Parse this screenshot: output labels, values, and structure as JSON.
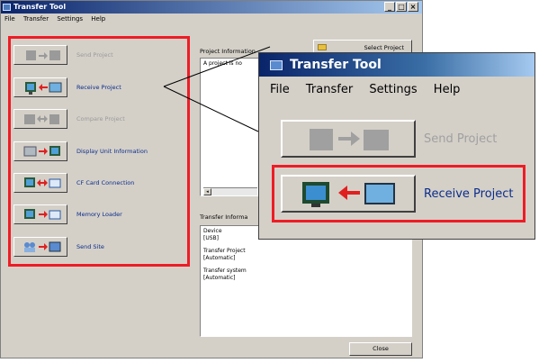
{
  "main_window": {
    "title": "Transfer Tool",
    "controls": {
      "minimize": "_",
      "maximize": "□",
      "close": "×"
    },
    "menu": [
      "File",
      "Transfer",
      "Settings",
      "Help"
    ],
    "buttons": [
      {
        "label": "Send Project",
        "enabled": false
      },
      {
        "label": "Receive Project",
        "enabled": true
      },
      {
        "label": "Compare Project",
        "enabled": false
      },
      {
        "label": "Display Unit Information",
        "enabled": true
      },
      {
        "label": "CF Card Connection",
        "enabled": true
      },
      {
        "label": "Memory Loader",
        "enabled": true
      },
      {
        "label": "Send Site",
        "enabled": true
      }
    ],
    "project_info": {
      "heading": "Project Information",
      "select_button": "Select Project",
      "text": "A project is no"
    },
    "transfer_info": {
      "heading": "Transfer Informa",
      "lines": [
        "Device",
        "[USB]",
        "",
        "Transfer Project",
        "[Automatic]",
        "",
        "Transfer system",
        "[Automatic]"
      ]
    },
    "close_button": "Close"
  },
  "zoom_window": {
    "title": "Transfer Tool",
    "menu": [
      "File",
      "Transfer",
      "Settings",
      "Help"
    ],
    "buttons": [
      {
        "label": "Send Project",
        "enabled": false
      },
      {
        "label": "Receive Project",
        "enabled": true
      }
    ]
  },
  "colors": {
    "highlight": "#ee1c25",
    "label_enabled": "#0b2d8c",
    "label_disabled": "#9a9a9a",
    "title_bar": "#0a246a"
  }
}
